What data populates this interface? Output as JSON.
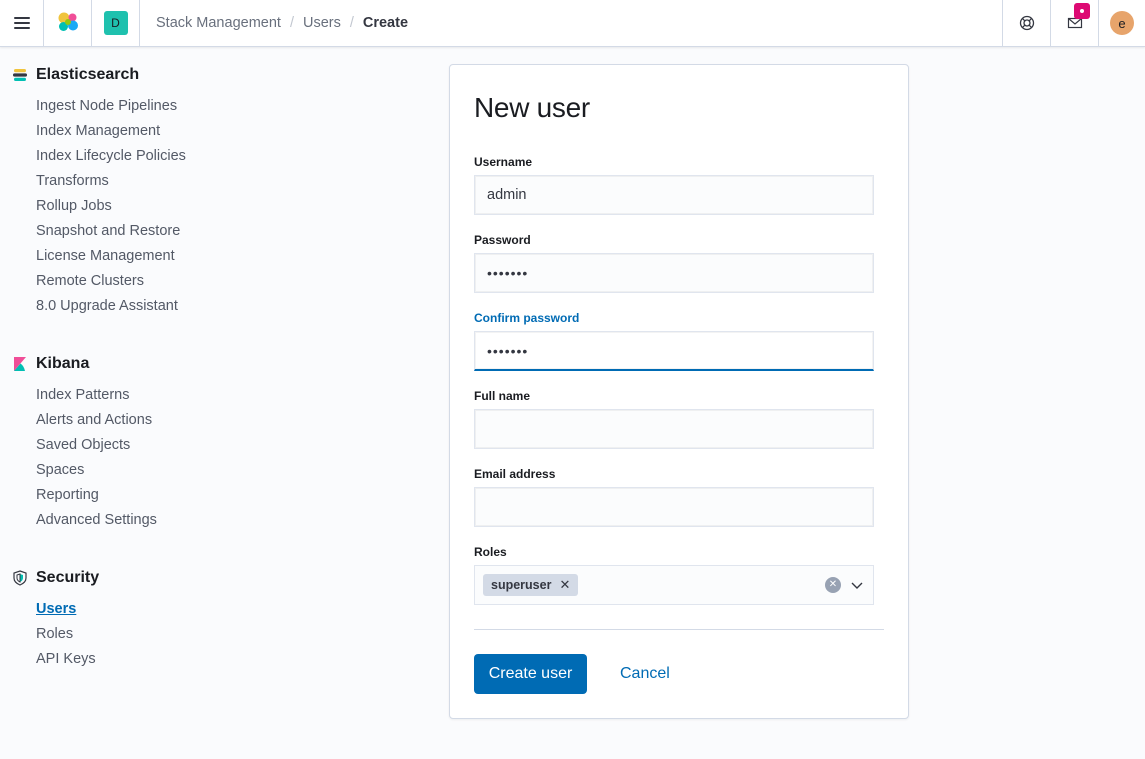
{
  "header": {
    "space_initial": "D",
    "breadcrumbs": [
      "Stack Management",
      "Users",
      "Create"
    ],
    "user_initial": "e",
    "colors": {
      "space_badge": "#1fc1ae",
      "avatar": "#e7a46b",
      "notification": "#dd0a73"
    }
  },
  "sidebar": {
    "sections": [
      {
        "title": "Elasticsearch",
        "icon": "elasticsearch-icon",
        "items": [
          "Ingest Node Pipelines",
          "Index Management",
          "Index Lifecycle Policies",
          "Transforms",
          "Rollup Jobs",
          "Snapshot and Restore",
          "License Management",
          "Remote Clusters",
          "8.0 Upgrade Assistant"
        ]
      },
      {
        "title": "Kibana",
        "icon": "kibana-icon",
        "items": [
          "Index Patterns",
          "Alerts and Actions",
          "Saved Objects",
          "Spaces",
          "Reporting",
          "Advanced Settings"
        ]
      },
      {
        "title": "Security",
        "icon": "shield-icon",
        "items": [
          "Users",
          "Roles",
          "API Keys"
        ],
        "active_item": "Users"
      }
    ]
  },
  "form": {
    "title": "New user",
    "username_label": "Username",
    "username_value": "admin",
    "password_label": "Password",
    "password_value": "•••••••",
    "confirm_label": "Confirm password",
    "confirm_value": "•••••••",
    "fullname_label": "Full name",
    "fullname_value": "",
    "email_label": "Email address",
    "email_value": "",
    "roles_label": "Roles",
    "roles": [
      "superuser"
    ],
    "submit_label": "Create user",
    "cancel_label": "Cancel",
    "accent_color": "#006bb4"
  }
}
